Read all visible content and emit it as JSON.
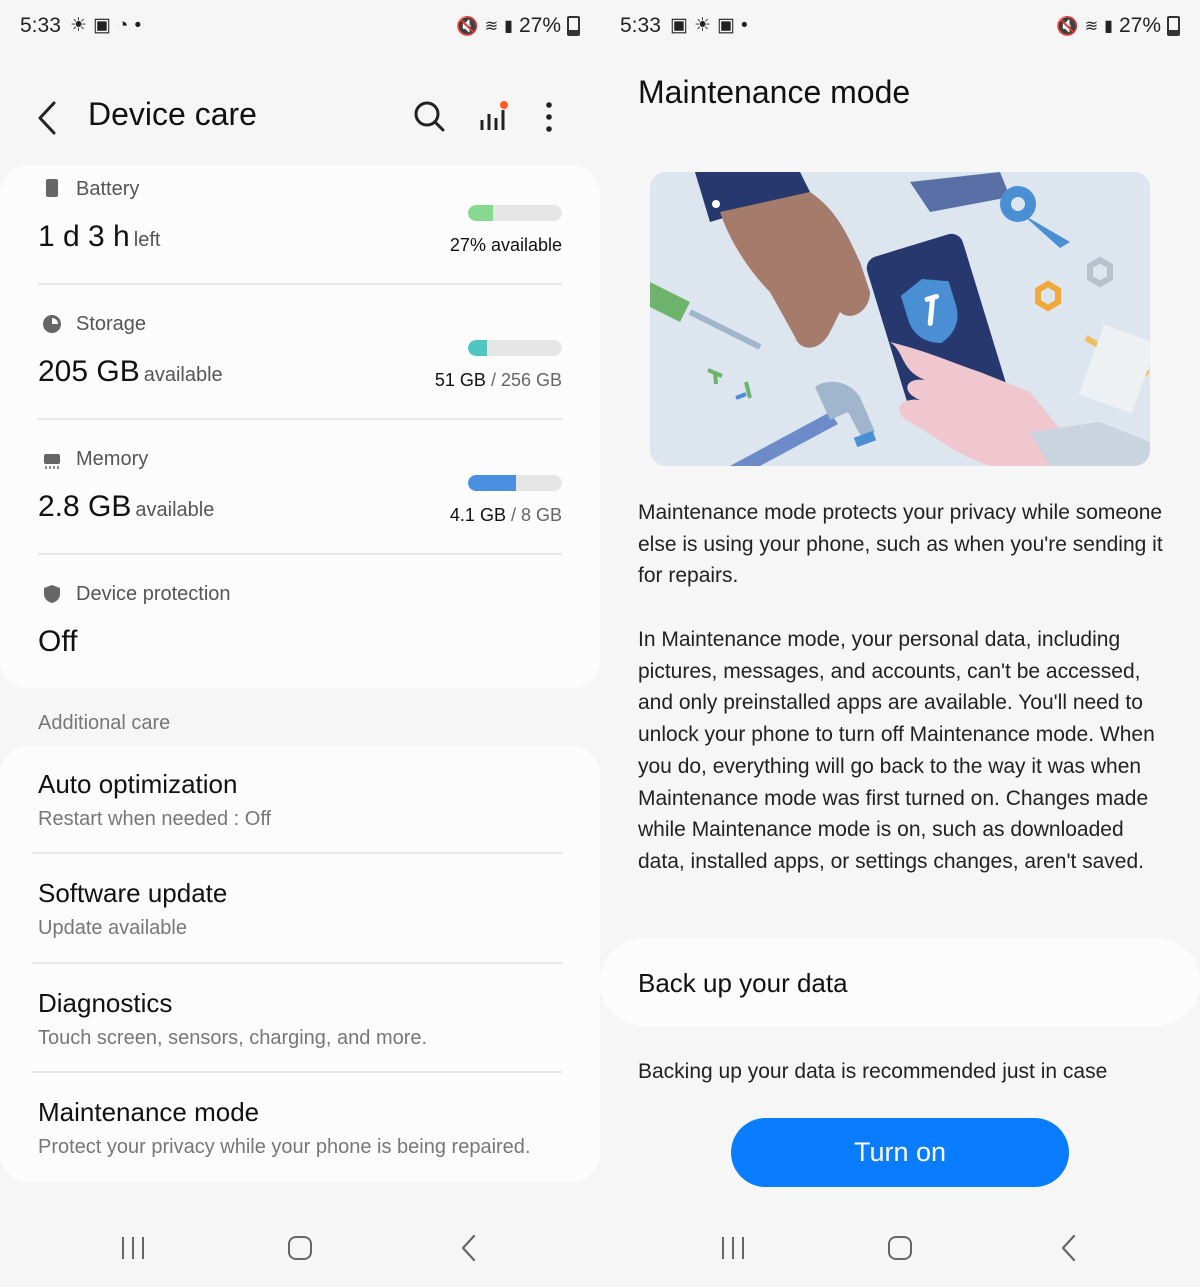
{
  "left": {
    "status": {
      "time": "5:33",
      "battery": "27%"
    },
    "appbar": {
      "title": "Device care"
    },
    "battery": {
      "label": "Battery",
      "value": "1 d 3 h",
      "unit": "left",
      "bar_text": "27% available",
      "fill_fraction": 0.27,
      "color": "#86d98e"
    },
    "storage": {
      "label": "Storage",
      "value": "205 GB",
      "unit": "available",
      "used": "51 GB",
      "total": "/ 256 GB",
      "fill_fraction": 0.2,
      "color": "#4fc6c0"
    },
    "memory": {
      "label": "Memory",
      "value": "2.8 GB",
      "unit": "available",
      "used": "4.1 GB",
      "total": "/ 8 GB",
      "fill_fraction": 0.51,
      "color": "#4b8fe0"
    },
    "protection": {
      "label": "Device protection",
      "value": "Off"
    },
    "additional": {
      "heading": "Additional care",
      "items": [
        {
          "title": "Auto optimization",
          "subtitle": "Restart when needed : Off"
        },
        {
          "title": "Software update",
          "subtitle": "Update available"
        },
        {
          "title": "Diagnostics",
          "subtitle": "Touch screen, sensors, charging, and more."
        },
        {
          "title": "Maintenance mode",
          "subtitle": "Protect your privacy while your phone is being repaired."
        }
      ]
    }
  },
  "right": {
    "status": {
      "time": "5:33",
      "battery": "27%"
    },
    "title": "Maintenance mode",
    "para1": "Maintenance mode protects your privacy while someone else is using your phone, such as when you're sending it for repairs.",
    "para2": "In Maintenance mode, your personal data, including pictures, messages, and accounts, can't be accessed, and only preinstalled apps are available. You'll need to unlock your phone to turn off Maintenance mode. When you do, everything will go back to the way it was when Maintenance mode was first turned on. Changes made while Maintenance mode is on, such as downloaded data, installed apps, or settings changes, aren't saved.",
    "backup": {
      "title": "Back up your data",
      "description": "Backing up your data is recommended just in case"
    },
    "button": "Turn on"
  }
}
